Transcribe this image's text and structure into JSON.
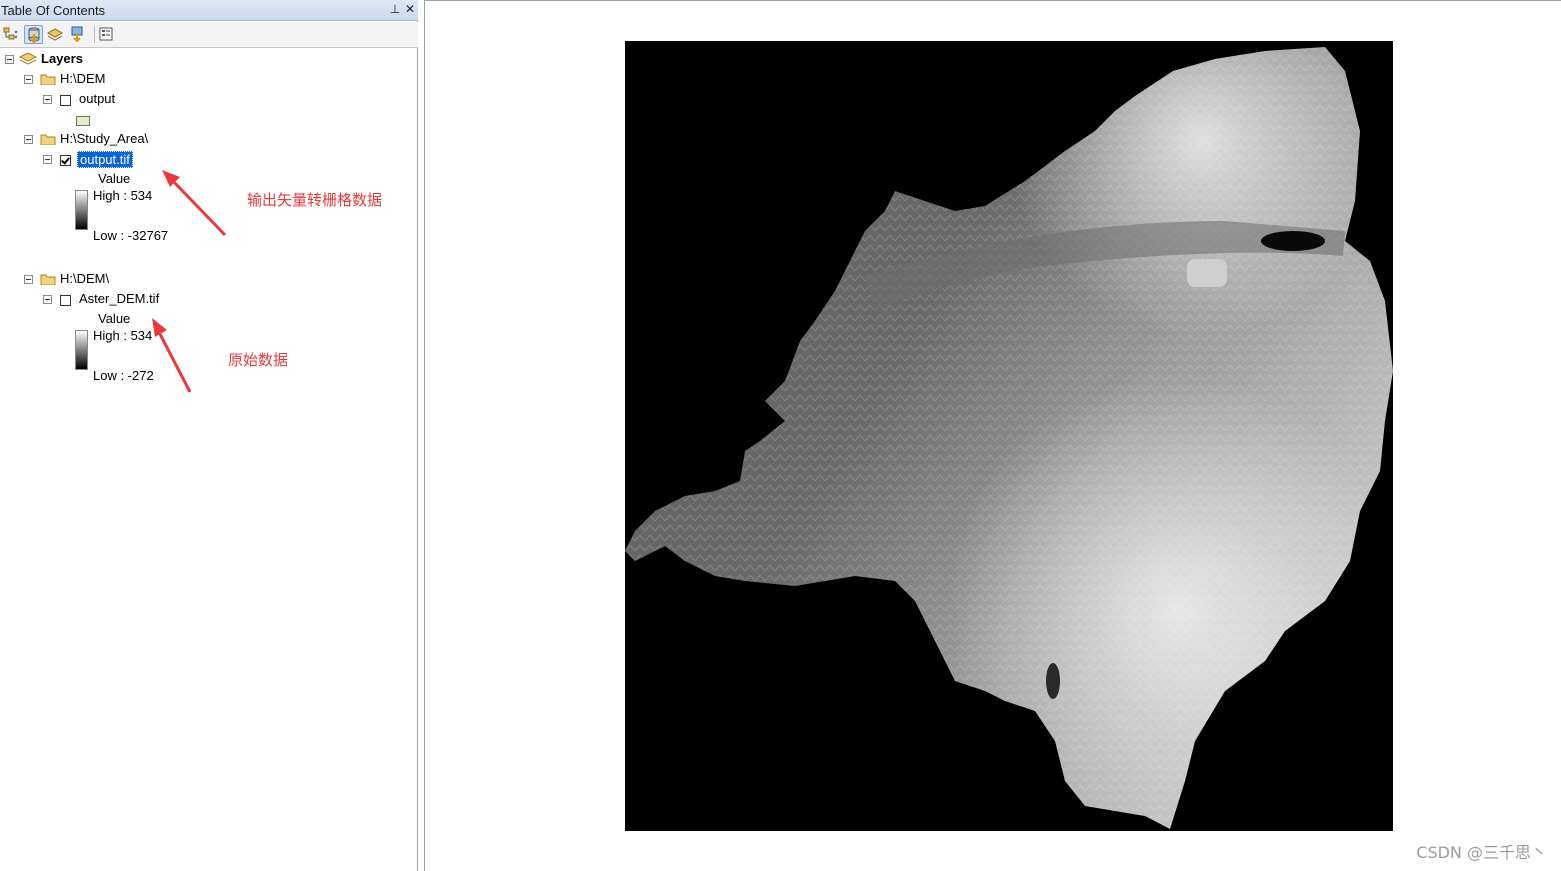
{
  "toc": {
    "title": "Table Of Contents",
    "pin_glyph": "⊥",
    "close_glyph": "✕",
    "toolbar": [
      "list-by-drawing-order-icon",
      "list-by-source-icon",
      "list-by-visibility-icon",
      "list-by-selection-icon",
      "options-icon"
    ],
    "root": "Layers",
    "groups": [
      {
        "path": "H:\\DEM",
        "layer": "output",
        "checked": false
      },
      {
        "path": "H:\\Study_Area\\",
        "layer": "output.tif",
        "checked": true,
        "selected": true,
        "legend_title": "Value",
        "high": "High : 534",
        "low": "Low : -32767"
      },
      {
        "path": "H:\\DEM\\",
        "layer": "Aster_DEM.tif",
        "checked": false,
        "legend_title": "Value",
        "high": "High : 534",
        "low": "Low : -272"
      }
    ]
  },
  "annotations": {
    "output_note": "输出矢量转栅格数据",
    "source_note": "原始数据",
    "color": "#e83a3a"
  },
  "map": {
    "background": "#000000",
    "watermark": "CSDN @三千思丶"
  }
}
